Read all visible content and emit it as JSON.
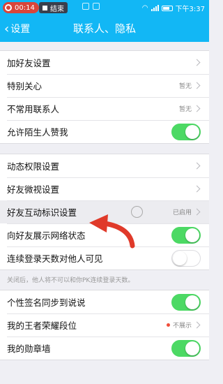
{
  "statusbar": {
    "recording_time": "00:14",
    "end_label": "结束",
    "clock": "下午3:37"
  },
  "navbar": {
    "back_label": "设置",
    "title": "联系人、隐私"
  },
  "groups": [
    [
      {
        "label": "加好友设置",
        "type": "arrow"
      },
      {
        "label": "特别关心",
        "type": "arrow",
        "value": "暂无"
      },
      {
        "label": "不常用联系人",
        "type": "arrow",
        "value": "暂无"
      },
      {
        "label": "允许陌生人赞我",
        "type": "toggle",
        "on": true
      }
    ],
    [
      {
        "label": "动态权限设置",
        "type": "arrow"
      },
      {
        "label": "好友微视设置",
        "type": "arrow"
      },
      {
        "label": "好友互动标识设置",
        "type": "arrow",
        "value": "已启用"
      },
      {
        "label": "向好友展示网络状态",
        "type": "toggle",
        "on": true
      },
      {
        "label": "连续登录天数对他人可见",
        "type": "toggle",
        "on": false
      }
    ],
    [
      {
        "label": "个性签名同步到说说",
        "type": "toggle",
        "on": true
      },
      {
        "label": "我的王者荣耀段位",
        "type": "arrow",
        "value": "不展示"
      },
      {
        "label": "我的勋章墙",
        "type": "toggle",
        "on": true
      }
    ]
  ],
  "note": "关闭后，他人将不可以和你PK连续登录天数。",
  "colors": {
    "accent": "#12b7f5",
    "toggle_on": "#4cd964",
    "annotation_arrow": "#e03a2a"
  }
}
